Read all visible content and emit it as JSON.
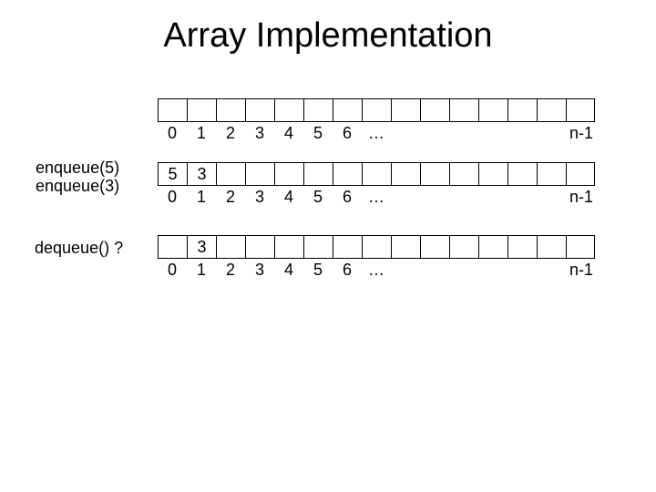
{
  "title": "Array Implementation",
  "labels": {
    "enqueue_line1": "enqueue(5)",
    "enqueue_line2": "enqueue(3)",
    "dequeue": "dequeue() ?"
  },
  "indices": {
    "0": "0",
    "1": "1",
    "2": "2",
    "3": "3",
    "4": "4",
    "5": "5",
    "6": "6",
    "ellipsis": "…",
    "end": "n-1"
  },
  "arrays": {
    "a1": {
      "cells": [
        "",
        "",
        "",
        "",
        "",
        "",
        "",
        "",
        "",
        "",
        "",
        "",
        "",
        "",
        ""
      ]
    },
    "a2": {
      "cells": [
        "5",
        "3",
        "",
        "",
        "",
        "",
        "",
        "",
        "",
        "",
        "",
        "",
        "",
        "",
        ""
      ]
    },
    "a3": {
      "cells": [
        "",
        "3",
        "",
        "",
        "",
        "",
        "",
        "",
        "",
        "",
        "",
        "",
        "",
        "",
        ""
      ]
    }
  }
}
